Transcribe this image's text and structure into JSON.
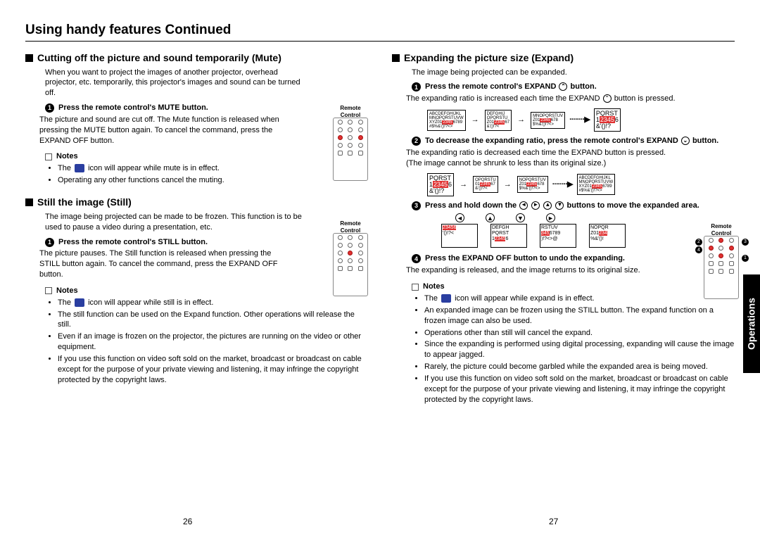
{
  "header": {
    "title": "Using handy features Continued"
  },
  "sideTab": "Operations",
  "pageNumbers": {
    "left": "26",
    "right": "27"
  },
  "left": {
    "mute": {
      "title": "Cutting off the picture and sound temporarily (Mute)",
      "intro": "When you want to project the images of another projector, overhead projector, etc. temporarily, this projector's images and sound can be turned off.",
      "step1_label": "Press the remote control's MUTE button.",
      "step1_body": "The picture and sound are cut off. The Mute function is released when pressing the MUTE button again. To cancel the command, press the EXPAND OFF button.",
      "notes_label": "Notes",
      "note1_a": "The",
      "note1_b": "icon will appear while mute is in effect.",
      "note2": "Operating any other functions cancel the muting.",
      "remote_label": "Remote Control"
    },
    "still": {
      "title": "Still the image (Still)",
      "intro": "The image being projected can be made to be frozen. This function is to be used to pause a video during a presentation, etc.",
      "step1_label": "Press the remote control's STILL button.",
      "step1_body": "The picture pauses. The Still function is released when pressing the STILL button again. To cancel the command, press the EXPAND OFF button.",
      "notes_label": "Notes",
      "note1_a": "The",
      "note1_b": "icon will appear while still is in effect.",
      "note2": "The still function can be used on the Expand function. Other operations will release the still.",
      "note3": "Even if an image is frozen on the projector, the pictures are running on the video or other equipment.",
      "note4": "If you use this function on video soft sold on the market, broadcast or broadcast on cable except for the purpose of your private viewing and listening, it may infringe the copyright protected by the copyright laws.",
      "remote_label": "Remote Control"
    }
  },
  "right": {
    "expand": {
      "title": "Expanding the picture size (Expand)",
      "intro": "The image being projected can be expanded.",
      "step1_a": "Press the remote control's EXPAND",
      "step1_b": "button.",
      "step1_body_a": "The expanding ratio is increased each time the EXPAND",
      "step1_body_b": "button is pressed.",
      "step2_a": "To decrease the expanding ratio, press the remote control's EXPAND",
      "step2_b": "button.",
      "step2_body": "The expanding ratio is decreased each time the EXPAND     button is pressed. (The image cannot be shrunk to less than its original size.)",
      "step3_a": "Press and hold down the",
      "step3_b": "buttons to move the expanded area.",
      "step4": "Press the EXPAND OFF button to undo the expanding.",
      "step4_body": "The expanding is released, and the image returns to its original size.",
      "notes_label": "Notes",
      "en1_a": "The",
      "en1_b": "icon will appear while expand is in effect.",
      "en2": "An expanded image can be frozen using the STILL button. The expand function on a frozen image can also be used.",
      "en3": "Operations other than still will cancel the expand.",
      "en4": "Since the expanding is performed using digital processing, expanding will cause the image to appear jagged.",
      "en5": "Rarely, the picture could become garbled while the expanded area is being moved.",
      "en6": "If you use this function on video soft sold on the market, broadcast or broadcast on cable except for the purpose of your private viewing and listening, it may infringe the copyright protected by the copyright laws.",
      "remote_label": "Remote Control",
      "zoom_sample": {
        "a": "ABCDEFGHIJKL MNOPQRSTUVW XYZ0123456789 &'()*!?<>",
        "dots": "········▶",
        "big": "PQRST 123456 &'()*!?"
      }
    }
  }
}
